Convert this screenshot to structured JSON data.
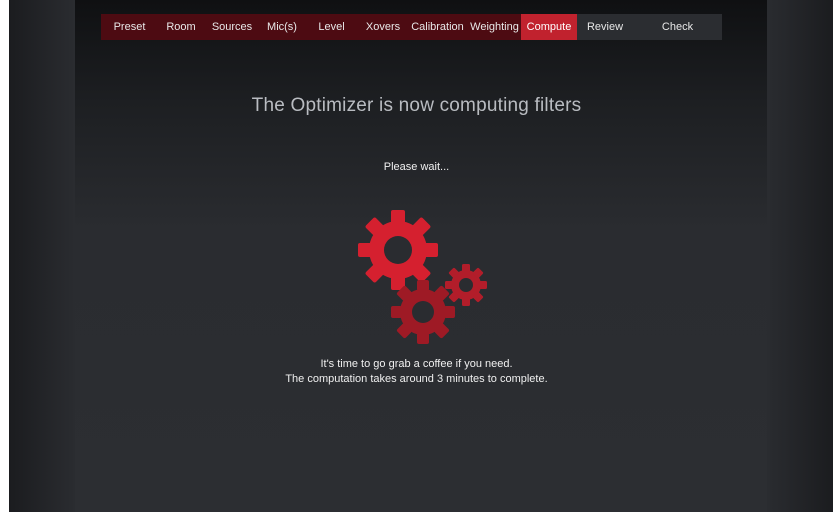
{
  "nav": {
    "items": [
      {
        "label": "Preset",
        "state": "done"
      },
      {
        "label": "Room",
        "state": "done"
      },
      {
        "label": "Sources",
        "state": "done"
      },
      {
        "label": "Mic(s)",
        "state": "done"
      },
      {
        "label": "Level",
        "state": "done"
      },
      {
        "label": "Xovers",
        "state": "done"
      },
      {
        "label": "Calibration",
        "state": "done"
      },
      {
        "label": "Weighting",
        "state": "done"
      },
      {
        "label": "Compute",
        "state": "active"
      },
      {
        "label": "Review",
        "state": "todo"
      },
      {
        "label": "Check",
        "state": "todo"
      }
    ]
  },
  "main": {
    "title": "The Optimizer is now computing filters",
    "status": "Please wait...",
    "note_line1": "It's time to go grab a coffee if you need.",
    "note_line2": "The computation takes around 3 minutes to complete.",
    "icon": "gears-icon"
  },
  "colors": {
    "accent": "#c1222e",
    "nav_done": "#4d0b12",
    "nav_todo": "#2b2d31",
    "gear_large": "#d5202f",
    "gear_medium": "#9e1a25",
    "gear_small": "#b21d2a"
  }
}
